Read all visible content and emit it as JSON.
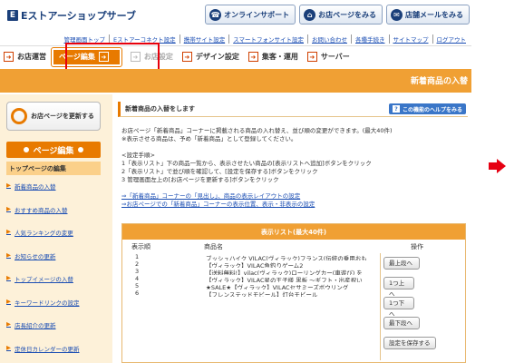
{
  "header": {
    "logo_text": "Eストアーショップサーブ",
    "buttons": [
      "オンラインサポート",
      "お店ページをみる",
      "店舗メールをみる"
    ],
    "sublinks": [
      "管理画面トップ",
      "Eストアーコネクト設定",
      "携帯サイト設定",
      "スマートフォンサイト設定",
      "お問い合わせ",
      "各種手続き",
      "サイトマップ",
      "ログアウト"
    ]
  },
  "nav": {
    "items": [
      "お店運営",
      "ページ編集",
      "お店設定",
      "デザイン設定",
      "集客・運用",
      "サーバー"
    ]
  },
  "page_title": "新着商品の入替",
  "sidebar": {
    "refresh_label": "お店ページを更新する",
    "section_title": "ページ編集",
    "top_item": "トップページの編集",
    "links": [
      "新着商品の入替",
      "おすすめ商品の入替",
      "人気ランキングの変更",
      "お知らせの更新",
      "トップイメージの入替",
      "キーワードリンクの設定",
      "店長紹介の更新",
      "定休日カレンダーの更新"
    ]
  },
  "main": {
    "section_title": "新着商品の入替をします",
    "help_label": "この機能のヘルプをみる",
    "intro": [
      "お店ページ「新着商品」コーナーに掲載される商品の入れ替え、並び順の変更ができます。(最大40件)",
      "※表示させる商品は、予め「新着商品」として登録してください。"
    ],
    "steps_title": "<設定手順>",
    "steps": [
      "1「表示リスト」下の商品一覧から、表示させたい商品の[表示リストへ追加]ボタンをクリック",
      "2「表示リスト」で並び順を確認して、[設定を保存する]ボタンをクリック",
      "3 管理画面左上の[お店ページを更新する]ボタンをクリック"
    ],
    "links": [
      "⇒「新着商品」コーナーの「見出し」、商品の表示レイアウトの設定",
      "⇒お店ページでの「新着商品」コーナーの表示位置、表示・非表示の設定"
    ],
    "list_title": "表示リスト(最大40件)",
    "col_order": "表示順",
    "col_name": "商品名",
    "col_ops": "操作",
    "rows": [
      {
        "n": "1",
        "t": "ブッシュハイク VILAC(ヴィラック)フランス(伝統の乗用おも"
      },
      {
        "n": "2",
        "t": "【ヴィラック】VILAC魚釣りゲーム2"
      },
      {
        "n": "3",
        "t": "【送料無料!】vilac(ヴィラック)ローリングカー(車遊び) を"
      },
      {
        "n": "4",
        "t": "【ヴィラック】VILAC星の王子様 黒板 ～ギフト・出産祝い"
      },
      {
        "n": "5",
        "t": "★SALE★【ヴィラック】VILACセサミーズボウリング"
      },
      {
        "n": "6",
        "t": "【フレンステッドモビール】灯台モビール"
      }
    ],
    "op_buttons": [
      "最上段へ",
      "1つ上へ",
      "1つ下へ",
      "最下段へ"
    ],
    "save_label": "設定を保存する"
  }
}
